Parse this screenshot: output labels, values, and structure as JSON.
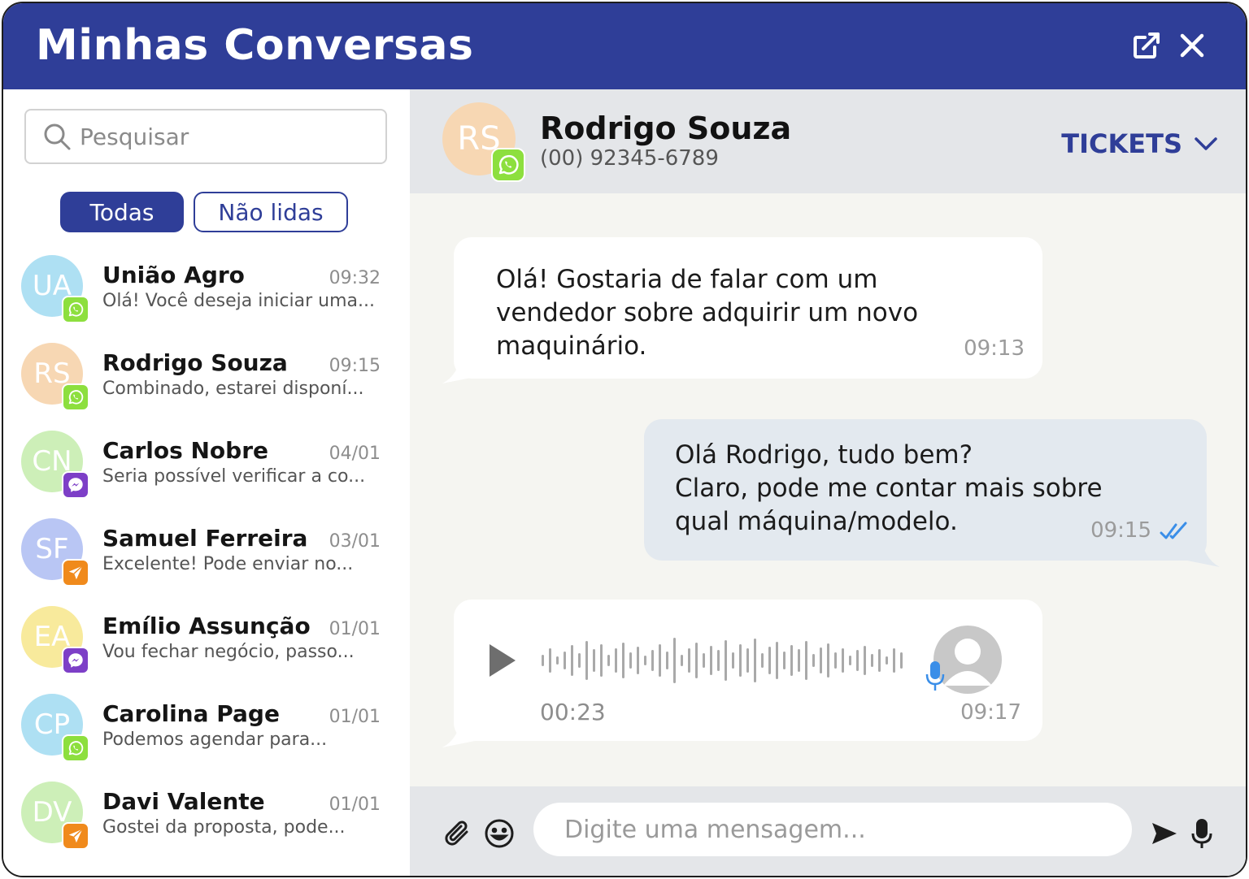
{
  "header": {
    "title": "Minhas Conversas",
    "open_icon": "external-link-icon",
    "close_icon": "close-icon"
  },
  "sidebar": {
    "search_placeholder": "Pesquisar",
    "filters": [
      {
        "label": "Todas",
        "active": true
      },
      {
        "label": "Não lidas",
        "active": false
      }
    ],
    "contacts": [
      {
        "initials": "UA",
        "name": "União Agro",
        "time": "09:32",
        "preview": "Olá! Você deseja iniciar uma...",
        "channel": "whatsapp",
        "color": "#aee0f3"
      },
      {
        "initials": "RS",
        "name": "Rodrigo Souza",
        "time": "09:15",
        "preview": "Combinado, estarei disponí...",
        "channel": "whatsapp",
        "color": "#f7d7b3"
      },
      {
        "initials": "CN",
        "name": "Carlos Nobre",
        "time": "04/01",
        "preview": "Seria possível verificar a co...",
        "channel": "messenger",
        "color": "#cdefb8"
      },
      {
        "initials": "SF",
        "name": "Samuel Ferreira",
        "time": "03/01",
        "preview": "Excelente! Pode enviar no...",
        "channel": "telegram",
        "color": "#b9c6f4"
      },
      {
        "initials": "EA",
        "name": "Emílio Assunção",
        "time": "01/01",
        "preview": "Vou fechar negócio, passo...",
        "channel": "messenger",
        "color": "#f8ea9c"
      },
      {
        "initials": "CP",
        "name": "Carolina Page",
        "time": "01/01",
        "preview": "Podemos agendar para...",
        "channel": "whatsapp",
        "color": "#aee0f3"
      },
      {
        "initials": "DV",
        "name": "Davi Valente",
        "time": "01/01",
        "preview": "Gostei da proposta, pode...",
        "channel": "telegram",
        "color": "#cdefb8"
      }
    ]
  },
  "chat": {
    "contact": {
      "initials": "RS",
      "name": "Rodrigo Souza",
      "phone": "(00) 92345-6789",
      "channel": "whatsapp",
      "color": "#f7d7b3"
    },
    "tickets_label": "TICKETS",
    "messages": [
      {
        "direction": "in",
        "lines": [
          "Olá! Gostaria de falar com um",
          "vendedor sobre adquirir um novo",
          "maquinário."
        ],
        "time": "09:13"
      },
      {
        "direction": "out",
        "lines": [
          "Olá Rodrigo, tudo bem?",
          "Claro, pode me contar mais sobre",
          "qual máquina/modelo."
        ],
        "time": "09:15",
        "status": "read"
      },
      {
        "direction": "in",
        "type": "audio",
        "duration": "00:23",
        "time": "09:17"
      }
    ],
    "composer": {
      "placeholder": "Digite uma mensagem..."
    }
  },
  "colors": {
    "brand": "#2f3e98",
    "whatsapp": "#8ddf3e",
    "messenger": "#7d3fc7",
    "telegram": "#f08a1c",
    "read_check": "#3a8ee8",
    "mic_blue": "#3a8ee8"
  }
}
